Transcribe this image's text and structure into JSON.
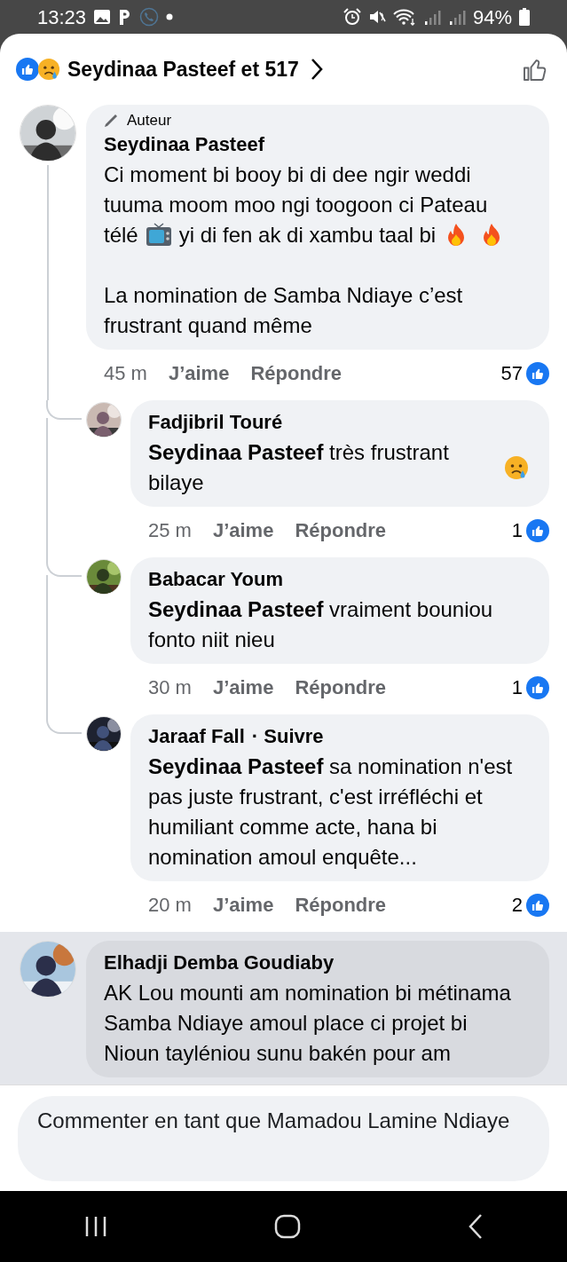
{
  "status_bar": {
    "time": "13:23",
    "battery": "94%"
  },
  "header": {
    "reactions_text": "Seydinaa Pasteef et 517"
  },
  "comments": [
    {
      "highlighted": false,
      "badge": "Auteur",
      "author": "Seydinaa Pasteef",
      "paragraphs": [
        [
          [
            {
              "kind": "text",
              "text": "Ci moment bi booy bi di dee ngir weddi tuuma moom moo ngi toogoon ci Pateau"
            }
          ],
          [
            {
              "kind": "text",
              "text": "télé"
            },
            {
              "kind": "tv"
            },
            {
              "kind": "text",
              "text": "yi di fen ak di xambu taal bi"
            },
            {
              "kind": "fire"
            },
            {
              "kind": "fire"
            }
          ]
        ],
        [
          [
            {
              "kind": "text",
              "text": "La nomination de Samba Ndiaye c’est frustrant quand même"
            }
          ]
        ]
      ],
      "time": "45 m",
      "like": "J’aime",
      "reply": "Répondre",
      "reaction_count": "57",
      "replies": [
        {
          "author": "Fadjibril Touré",
          "paragraphs": [
            [
              [
                {
                  "kind": "text",
                  "text": "**Seydinaa Pasteef** très frustrant bilaye"
                },
                {
                  "kind": "tear"
                }
              ]
            ]
          ],
          "time": "25 m",
          "like": "J’aime",
          "reply": "Répondre",
          "reaction_count": "1"
        },
        {
          "author": "Babacar Youm",
          "paragraphs": [
            [
              [
                {
                  "kind": "text",
                  "text": "**Seydinaa Pasteef** vraiment  bouniou fonto niit nieu"
                }
              ]
            ]
          ],
          "time": "30 m",
          "like": "J’aime",
          "reply": "Répondre",
          "reaction_count": "1"
        },
        {
          "author": "Jaraaf Fall",
          "follow": "· Suivre",
          "paragraphs": [
            [
              [
                {
                  "kind": "text",
                  "text": "**Seydinaa Pasteef** sa nomination n'est pas juste frustrant, c'est irréfléchi et humiliant comme acte, hana bi nomination amoul enquête..."
                }
              ]
            ]
          ],
          "time": "20 m",
          "like": "J’aime",
          "reply": "Répondre",
          "reaction_count": "2"
        }
      ]
    },
    {
      "highlighted": true,
      "author": "Elhadji Demba Goudiaby",
      "paragraphs": [
        [
          [
            {
              "kind": "text",
              "text": "AK Lou mounti am nomination bi métinama"
            }
          ]
        ],
        [
          [
            {
              "kind": "text",
              "text": "Samba Ndiaye amoul place ci projet bi"
            }
          ]
        ],
        [
          [
            {
              "kind": "text",
              "text": "Nioun tayléniou sunu bakén pour am"
            }
          ]
        ]
      ]
    }
  ],
  "composer": {
    "placeholder": "Commenter en tant que Mamadou Lamine Ndiaye"
  }
}
